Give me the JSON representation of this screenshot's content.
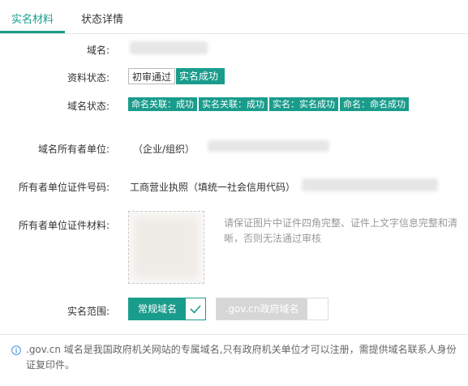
{
  "tabs": [
    {
      "label": "实名材料",
      "active": true
    },
    {
      "label": "状态详情",
      "active": false
    }
  ],
  "form": {
    "domain": {
      "label": "域名:"
    },
    "material_status": {
      "label": "资料状态:",
      "values": [
        "初审通过",
        "实名成功"
      ]
    },
    "domain_status": {
      "label": "域名状态:",
      "badges": [
        "命名关联：成功",
        "实名关联：成功",
        "实名：实名成功",
        "命名：命名成功"
      ]
    },
    "owner_unit": {
      "label": "域名所有者单位:",
      "value": "（企业/组织）"
    },
    "cert_number": {
      "label": "所有者单位证件号码:",
      "value": "工商营业执照（填统一社会信用代码）"
    },
    "cert_material": {
      "label": "所有者单位证件材料:",
      "hint": "请保证图片中证件四角完整、证件上文字信息完整和清晰，否则无法通过审核"
    },
    "scope": {
      "label": "实名范围:",
      "options": [
        "常规域名",
        ".gov.cn政府域名"
      ],
      "selected": 0
    }
  },
  "notice": {
    "text": ".gov.cn 域名是我国政府机关网站的专属域名,只有政府机关单位才可以注册，需提供域名联系人身份证复印件。"
  },
  "colors": {
    "accent": "#1a9c8c",
    "notice_icon": "#3b8ee0"
  }
}
